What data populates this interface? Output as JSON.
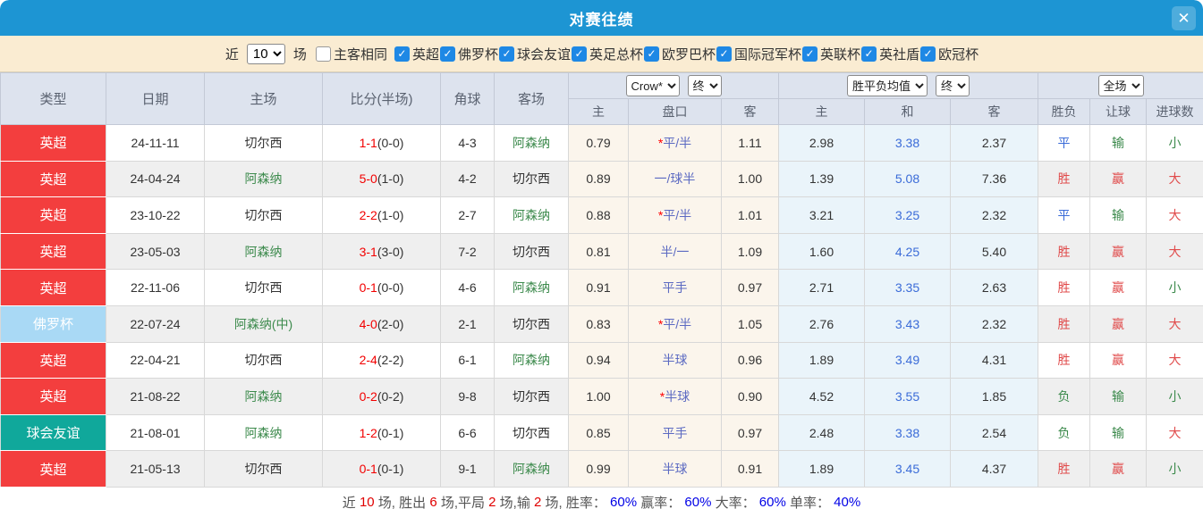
{
  "window": {
    "title": "对赛往绩",
    "close_icon": "✕"
  },
  "filter": {
    "recent_label": "近",
    "recent_value": "10",
    "games_label": "场",
    "same_venue": {
      "label": "主客相同",
      "checked": false
    },
    "competitions": [
      {
        "label": "英超",
        "checked": true
      },
      {
        "label": "佛罗杯",
        "checked": true
      },
      {
        "label": "球会友谊",
        "checked": true
      },
      {
        "label": "英足总杯",
        "checked": true
      },
      {
        "label": "欧罗巴杯",
        "checked": true
      },
      {
        "label": "国际冠军杯",
        "checked": true
      },
      {
        "label": "英联杯",
        "checked": true
      },
      {
        "label": "英社盾",
        "checked": true
      },
      {
        "label": "欧冠杯",
        "checked": true
      }
    ]
  },
  "table": {
    "selects": {
      "bookmaker": "Crow*",
      "bookmaker_time": "终",
      "avg": "胜平负均值",
      "avg_time": "终",
      "scope": "全场"
    },
    "headers": {
      "type": "类型",
      "date": "日期",
      "home": "主场",
      "score": "比分(半场)",
      "corner": "角球",
      "away": "客场",
      "odds_home": "主",
      "odds_handicap": "盘口",
      "odds_away": "客",
      "avg_home": "主",
      "avg_draw": "和",
      "avg_away": "客",
      "result_wdl": "胜负",
      "result_handicap": "让球",
      "result_goals": "进球数"
    },
    "rows": [
      {
        "type": {
          "label": "英超",
          "color": "red"
        },
        "date": "24-11-11",
        "home": {
          "name": "切尔西",
          "color": "dark"
        },
        "score_ft": "1-1",
        "score_ht": "(0-0)",
        "corners": "4-3",
        "away": {
          "name": "阿森纳",
          "color": "green"
        },
        "odds_home": "0.79",
        "handicap_star": true,
        "handicap": "平/半",
        "odds_away": "1.11",
        "avg_home": "2.98",
        "avg_draw": "3.38",
        "avg_away": "2.37",
        "wdl": {
          "text": "平",
          "color": "blue"
        },
        "let": {
          "text": "输",
          "color": "green"
        },
        "goals": {
          "text": "小",
          "color": "green"
        }
      },
      {
        "type": {
          "label": "英超",
          "color": "red"
        },
        "date": "24-04-24",
        "home": {
          "name": "阿森纳",
          "color": "green"
        },
        "score_ft": "5-0",
        "score_ht": "(1-0)",
        "corners": "4-2",
        "away": {
          "name": "切尔西",
          "color": "dark"
        },
        "odds_home": "0.89",
        "handicap_star": false,
        "handicap": "一/球半",
        "odds_away": "1.00",
        "avg_home": "1.39",
        "avg_draw": "5.08",
        "avg_away": "7.36",
        "wdl": {
          "text": "胜",
          "color": "red"
        },
        "let": {
          "text": "赢",
          "color": "red"
        },
        "goals": {
          "text": "大",
          "color": "red"
        }
      },
      {
        "type": {
          "label": "英超",
          "color": "red"
        },
        "date": "23-10-22",
        "home": {
          "name": "切尔西",
          "color": "dark"
        },
        "score_ft": "2-2",
        "score_ht": "(1-0)",
        "corners": "2-7",
        "away": {
          "name": "阿森纳",
          "color": "green"
        },
        "odds_home": "0.88",
        "handicap_star": true,
        "handicap": "平/半",
        "odds_away": "1.01",
        "avg_home": "3.21",
        "avg_draw": "3.25",
        "avg_away": "2.32",
        "wdl": {
          "text": "平",
          "color": "blue"
        },
        "let": {
          "text": "输",
          "color": "green"
        },
        "goals": {
          "text": "大",
          "color": "red"
        }
      },
      {
        "type": {
          "label": "英超",
          "color": "red"
        },
        "date": "23-05-03",
        "home": {
          "name": "阿森纳",
          "color": "green"
        },
        "score_ft": "3-1",
        "score_ht": "(3-0)",
        "corners": "7-2",
        "away": {
          "name": "切尔西",
          "color": "dark"
        },
        "odds_home": "0.81",
        "handicap_star": false,
        "handicap": "半/一",
        "odds_away": "1.09",
        "avg_home": "1.60",
        "avg_draw": "4.25",
        "avg_away": "5.40",
        "wdl": {
          "text": "胜",
          "color": "red"
        },
        "let": {
          "text": "赢",
          "color": "red"
        },
        "goals": {
          "text": "大",
          "color": "red"
        }
      },
      {
        "type": {
          "label": "英超",
          "color": "red"
        },
        "date": "22-11-06",
        "home": {
          "name": "切尔西",
          "color": "dark"
        },
        "score_ft": "0-1",
        "score_ht": "(0-0)",
        "corners": "4-6",
        "away": {
          "name": "阿森纳",
          "color": "green"
        },
        "odds_home": "0.91",
        "handicap_star": false,
        "handicap": "平手",
        "odds_away": "0.97",
        "avg_home": "2.71",
        "avg_draw": "3.35",
        "avg_away": "2.63",
        "wdl": {
          "text": "胜",
          "color": "red"
        },
        "let": {
          "text": "赢",
          "color": "red"
        },
        "goals": {
          "text": "小",
          "color": "green"
        }
      },
      {
        "type": {
          "label": "佛罗杯",
          "color": "lightblue"
        },
        "date": "22-07-24",
        "home": {
          "name": "阿森纳(中)",
          "color": "green"
        },
        "score_ft": "4-0",
        "score_ht": "(2-0)",
        "corners": "2-1",
        "away": {
          "name": "切尔西",
          "color": "dark"
        },
        "odds_home": "0.83",
        "handicap_star": true,
        "handicap": "平/半",
        "odds_away": "1.05",
        "avg_home": "2.76",
        "avg_draw": "3.43",
        "avg_away": "2.32",
        "wdl": {
          "text": "胜",
          "color": "red"
        },
        "let": {
          "text": "赢",
          "color": "red"
        },
        "goals": {
          "text": "大",
          "color": "red"
        }
      },
      {
        "type": {
          "label": "英超",
          "color": "red"
        },
        "date": "22-04-21",
        "home": {
          "name": "切尔西",
          "color": "dark"
        },
        "score_ft": "2-4",
        "score_ht": "(2-2)",
        "corners": "6-1",
        "away": {
          "name": "阿森纳",
          "color": "green"
        },
        "odds_home": "0.94",
        "handicap_star": false,
        "handicap": "半球",
        "odds_away": "0.96",
        "avg_home": "1.89",
        "avg_draw": "3.49",
        "avg_away": "4.31",
        "wdl": {
          "text": "胜",
          "color": "red"
        },
        "let": {
          "text": "赢",
          "color": "red"
        },
        "goals": {
          "text": "大",
          "color": "red"
        }
      },
      {
        "type": {
          "label": "英超",
          "color": "red"
        },
        "date": "21-08-22",
        "home": {
          "name": "阿森纳",
          "color": "green"
        },
        "score_ft": "0-2",
        "score_ht": "(0-2)",
        "corners": "9-8",
        "away": {
          "name": "切尔西",
          "color": "dark"
        },
        "odds_home": "1.00",
        "handicap_star": true,
        "handicap": "半球",
        "odds_away": "0.90",
        "avg_home": "4.52",
        "avg_draw": "3.55",
        "avg_away": "1.85",
        "wdl": {
          "text": "负",
          "color": "green"
        },
        "let": {
          "text": "输",
          "color": "green"
        },
        "goals": {
          "text": "小",
          "color": "green"
        }
      },
      {
        "type": {
          "label": "球会友谊",
          "color": "teal"
        },
        "date": "21-08-01",
        "home": {
          "name": "阿森纳",
          "color": "green"
        },
        "score_ft": "1-2",
        "score_ht": "(0-1)",
        "corners": "6-6",
        "away": {
          "name": "切尔西",
          "color": "dark"
        },
        "odds_home": "0.85",
        "handicap_star": false,
        "handicap": "平手",
        "odds_away": "0.97",
        "avg_home": "2.48",
        "avg_draw": "3.38",
        "avg_away": "2.54",
        "wdl": {
          "text": "负",
          "color": "green"
        },
        "let": {
          "text": "输",
          "color": "green"
        },
        "goals": {
          "text": "大",
          "color": "red"
        }
      },
      {
        "type": {
          "label": "英超",
          "color": "red"
        },
        "date": "21-05-13",
        "home": {
          "name": "切尔西",
          "color": "dark"
        },
        "score_ft": "0-1",
        "score_ht": "(0-1)",
        "corners": "9-1",
        "away": {
          "name": "阿森纳",
          "color": "green"
        },
        "odds_home": "0.99",
        "handicap_star": false,
        "handicap": "半球",
        "odds_away": "0.91",
        "avg_home": "1.89",
        "avg_draw": "3.45",
        "avg_away": "4.37",
        "wdl": {
          "text": "胜",
          "color": "red"
        },
        "let": {
          "text": "赢",
          "color": "red"
        },
        "goals": {
          "text": "小",
          "color": "green"
        }
      }
    ]
  },
  "summary": {
    "parts": [
      {
        "t": "近 ",
        "c": "base"
      },
      {
        "t": "10",
        "c": "red"
      },
      {
        "t": " 场, 胜出 ",
        "c": "base"
      },
      {
        "t": "6",
        "c": "red"
      },
      {
        "t": " 场,平局 ",
        "c": "base"
      },
      {
        "t": "2",
        "c": "red"
      },
      {
        "t": " 场,输 ",
        "c": "base"
      },
      {
        "t": "2",
        "c": "red"
      },
      {
        "t": " 场, 胜率： ",
        "c": "base"
      },
      {
        "t": "60%",
        "c": "blue"
      },
      {
        "t": " 赢率： ",
        "c": "base"
      },
      {
        "t": "60%",
        "c": "blue"
      },
      {
        "t": " 大率： ",
        "c": "base"
      },
      {
        "t": "60%",
        "c": "blue"
      },
      {
        "t": " 单率： ",
        "c": "base"
      },
      {
        "t": "40%",
        "c": "blue"
      }
    ]
  },
  "colors": {
    "title_bar": "#1d95d3",
    "filter_bar_bg": "#faecd2",
    "header_bg": "#dde3ee",
    "odds_group_bg": "#fbf5ec",
    "avg_group_bg": "#eaf4fa",
    "alt_row_bg": "#efefef",
    "checkbox_blue": "#1e88e5",
    "score_red": "#f20000",
    "text_red": "#e04a4a",
    "text_green": "#3c8a4c",
    "text_blue": "#3a6bd8",
    "text_indigo": "#5c6ac2",
    "footer_num_red": "#e00000",
    "footer_pct_blue": "#0000e6",
    "badge_red": "#f33e3e",
    "badge_lightblue": "#a9d9f5",
    "badge_teal": "#10a89b"
  }
}
